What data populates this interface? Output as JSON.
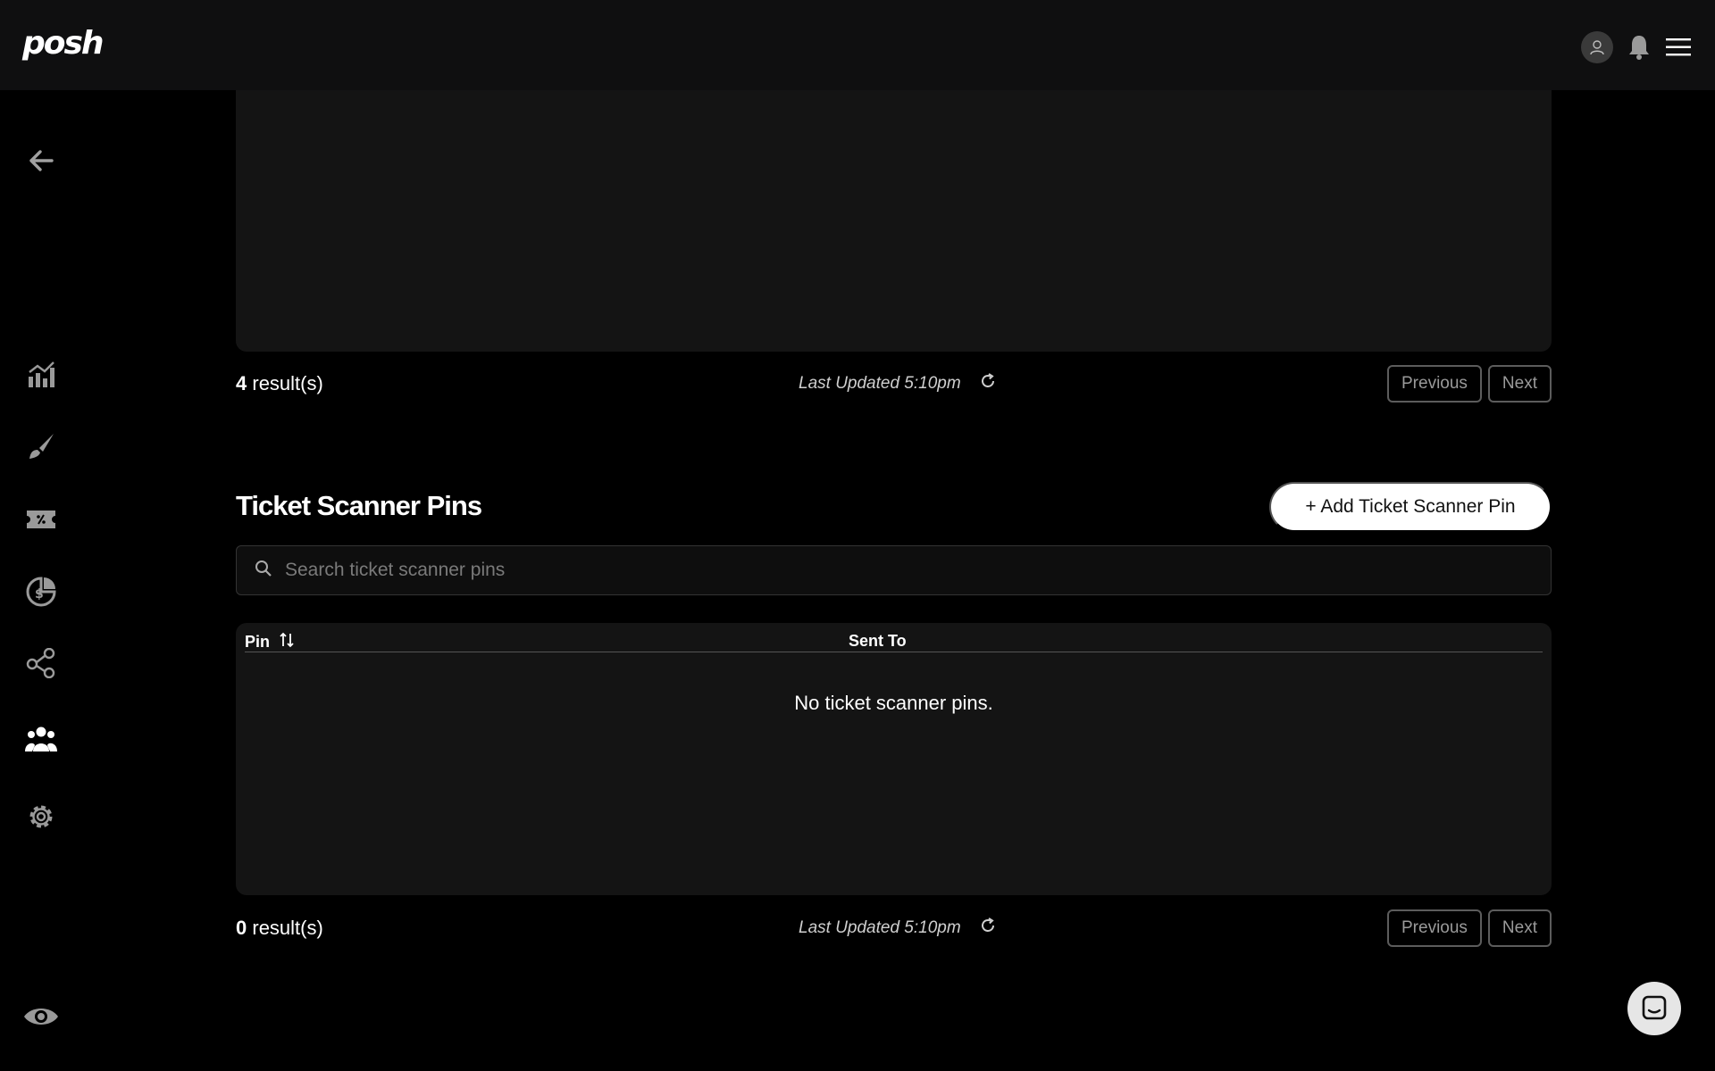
{
  "header": {
    "logo": "posh"
  },
  "sidebar": {
    "items": [
      {
        "icon": "back-arrow-icon"
      },
      {
        "icon": "analytics-icon"
      },
      {
        "icon": "brush-icon"
      },
      {
        "icon": "ticket-icon"
      },
      {
        "icon": "finance-icon"
      },
      {
        "icon": "network-icon"
      },
      {
        "icon": "team-icon",
        "active": true
      },
      {
        "icon": "gear-icon"
      },
      {
        "icon": "eye-icon"
      }
    ]
  },
  "top_table": {
    "count": "4",
    "count_suffix": " result(s)",
    "last_updated": "Last Updated 5:10pm",
    "previous_label": "Previous",
    "next_label": "Next"
  },
  "scanner_pins": {
    "title": "Ticket Scanner Pins",
    "add_button": "+ Add Ticket Scanner Pin",
    "search_placeholder": "Search ticket scanner pins",
    "columns": [
      "Pin",
      "Sent To"
    ],
    "empty_message": "No ticket scanner pins.",
    "count": "0",
    "count_suffix": " result(s)",
    "last_updated": "Last Updated 5:10pm",
    "previous_label": "Previous",
    "next_label": "Next"
  },
  "colors": {
    "background": "#000000",
    "panel": "#141414",
    "topbar": "#0f0f10",
    "accent_button": "#ffffff"
  }
}
